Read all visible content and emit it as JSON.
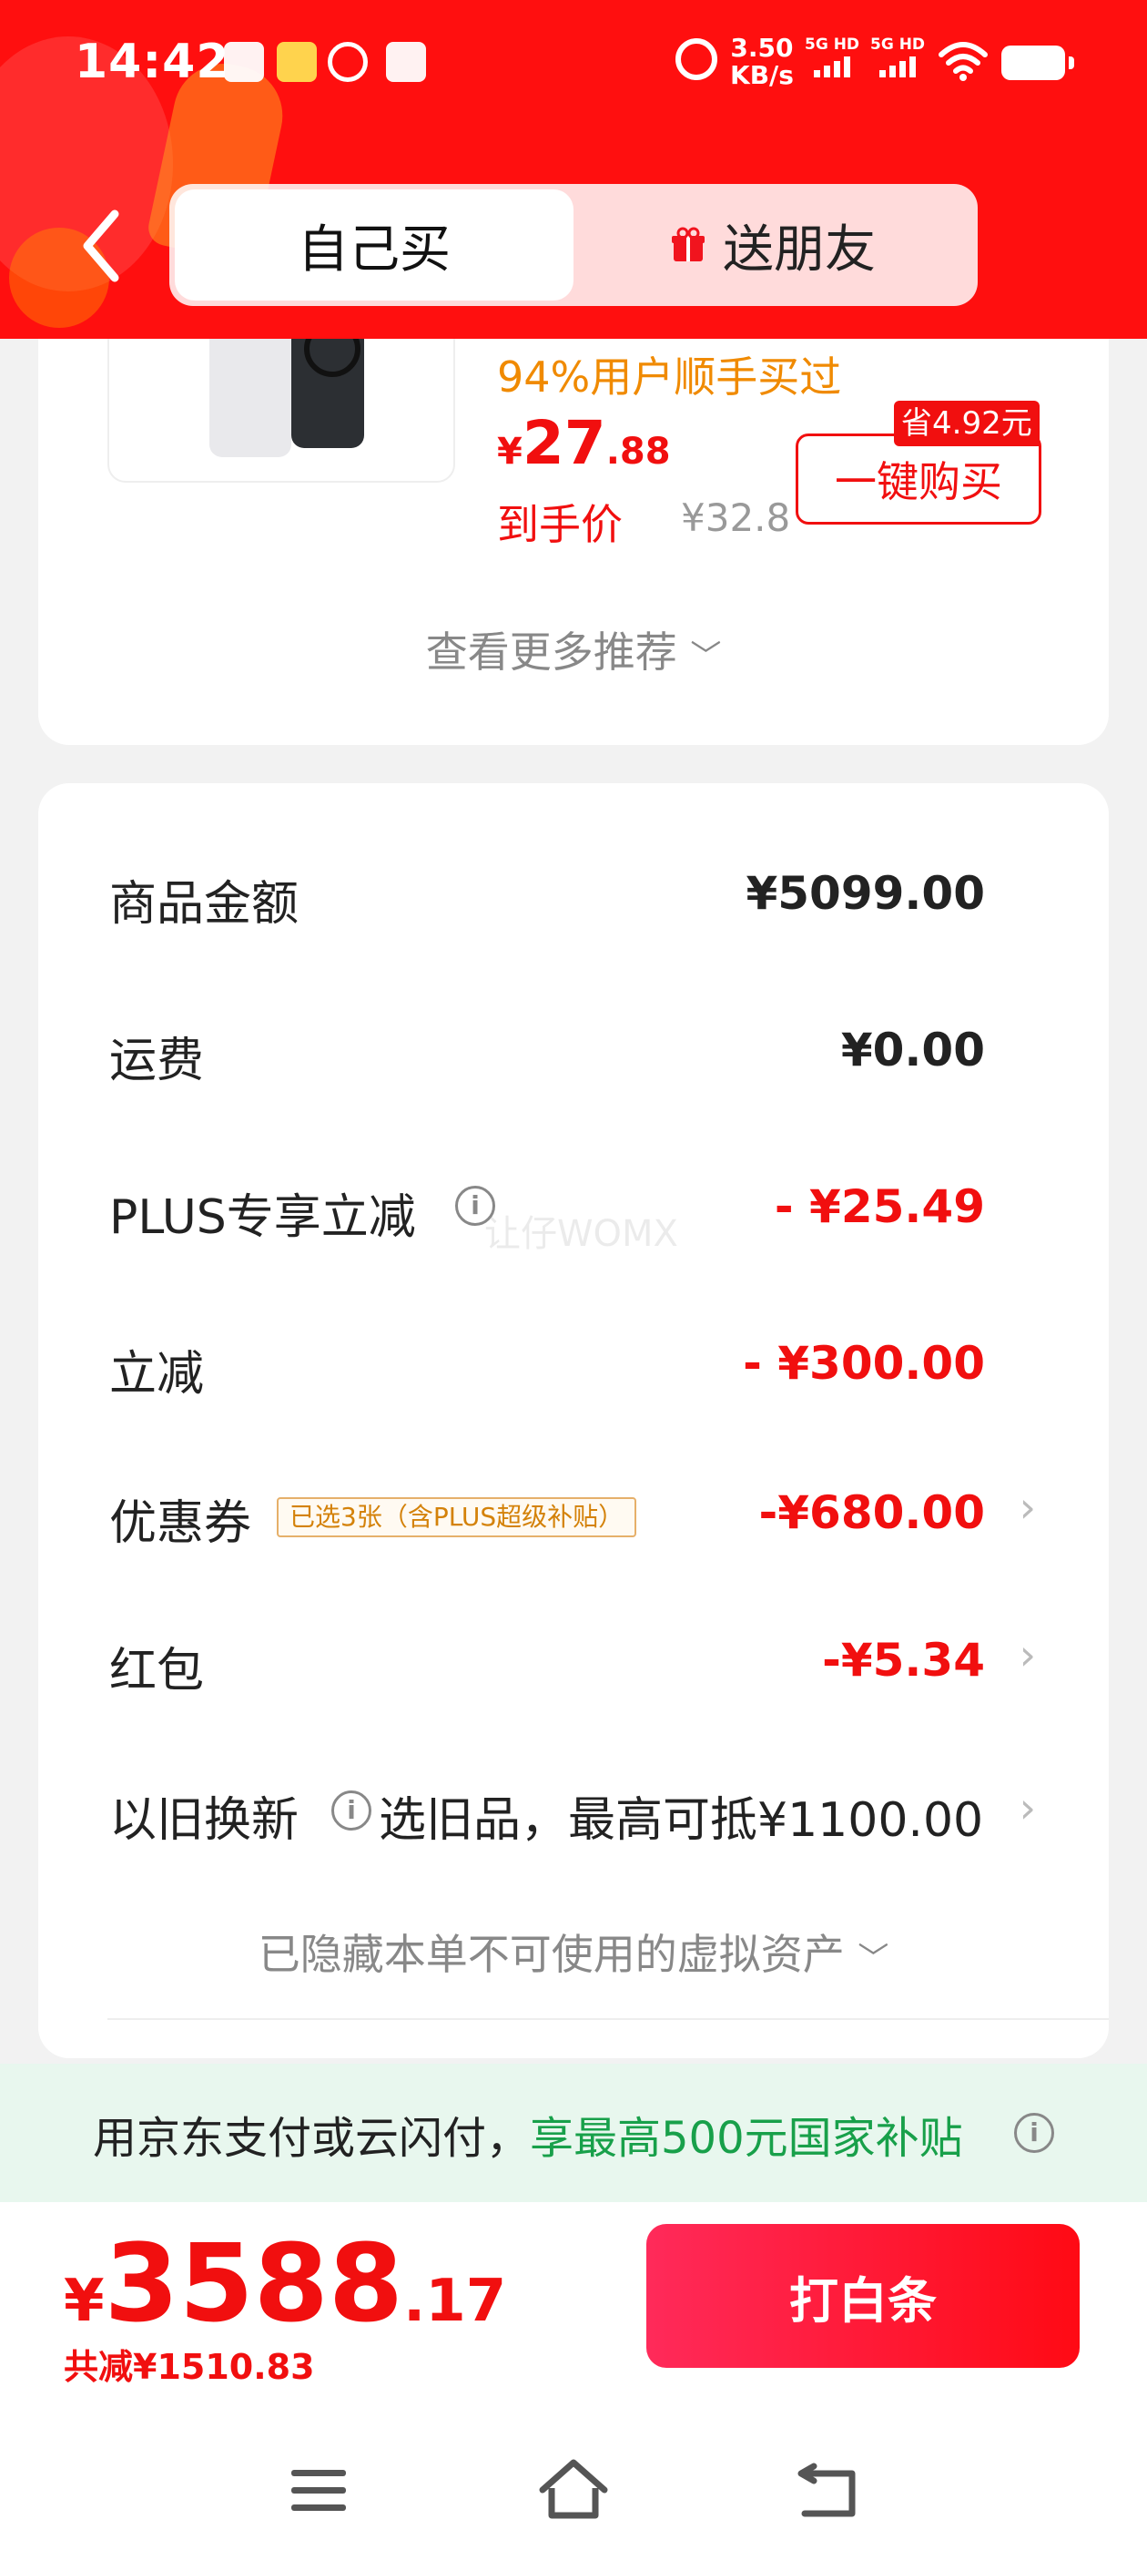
{
  "status_bar": {
    "time": "14:42",
    "net_speed_value": "3.50",
    "net_speed_unit": "KB/s",
    "signal1": "5G HD",
    "signal2": "5G HD"
  },
  "tabs": {
    "active": "自己买",
    "inactive": "送朋友"
  },
  "recommendation": {
    "bought_text": "94%用户顺手买过",
    "price_symbol": "¥",
    "price_int": "27",
    "price_dec": ".88",
    "final_price_label": "到手价",
    "original_price": "¥32.8",
    "save_tag": "省4.92元",
    "buy_button": "一键购买",
    "more": "查看更多推荐",
    "more_chevron": "﹀"
  },
  "breakdown": {
    "goods_label": "商品金额",
    "goods_value": "¥5099.00",
    "shipping_label": "运费",
    "shipping_value": "¥0.00",
    "plus_label": "PLUS专享立减",
    "plus_value": "- ¥25.49",
    "instant_label": "立减",
    "instant_value": "- ¥300.00",
    "coupon_label": "优惠券",
    "coupon_tag": "已选3张（含PLUS超级补贴）",
    "coupon_value": "-¥680.00",
    "redpacket_label": "红包",
    "redpacket_value": "-¥5.34",
    "tradein_label": "以旧换新",
    "tradein_value": "选旧品，最高可抵¥1100.00",
    "hidden_assets": "已隐藏本单不可使用的虚拟资产",
    "watermark": "让仔WOMX"
  },
  "subsidy": {
    "text_prefix": "用京东支付或云闪付，",
    "text_highlight": "享最高500元国家补贴"
  },
  "bottom": {
    "price_symbol": "¥",
    "price_int": "3588",
    "price_dec": ".17",
    "saved": "共减¥1510.83",
    "pay_button": "打白条"
  },
  "icons": {
    "back": "chevron-left-icon",
    "gift": "gift-icon",
    "info": "info-icon",
    "chevron": "chevron-right-icon",
    "menu": "menu-icon",
    "home": "home-icon",
    "return": "back-nav-icon"
  },
  "colors": {
    "brand_red": "#ff0f0f",
    "price_red": "#f10f0f",
    "accent_orange": "#f08a00",
    "subsidy_green": "#18a04a"
  }
}
